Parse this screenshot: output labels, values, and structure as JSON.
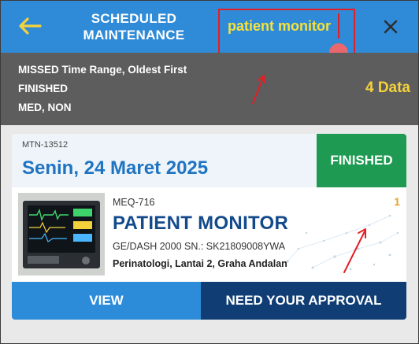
{
  "header": {
    "title_line1": "SCHEDULED",
    "title_line2": "MAINTENANCE",
    "search_value": "patient monitor"
  },
  "filters": {
    "line1": "MISSED Time Range, Oldest First",
    "line2": "FINISHED",
    "line3": "MED, NON",
    "count": "4 Data"
  },
  "card": {
    "mtn": "MTN-13512",
    "date": "Senin, 24 Maret 2025",
    "status": "FINISHED",
    "asset_code": "MEQ-716",
    "asset_name": "PATIENT MONITOR",
    "asset_model": "GE/DASH 2000  SN.: SK21809008YWA",
    "location": "Perinatologi, Lantai 2, Graha Andalan",
    "count": "1",
    "actions": {
      "view": "VIEW",
      "approve": "NEED YOUR APPROVAL"
    }
  },
  "colors": {
    "header": "#2f8bd7",
    "filter_bar": "#5d5d5d",
    "status": "#1f9a52",
    "view_button": "#2d8cd9",
    "approve_button": "#103d74",
    "search_text": "#f6e23a",
    "annotation": "#e11f26"
  }
}
